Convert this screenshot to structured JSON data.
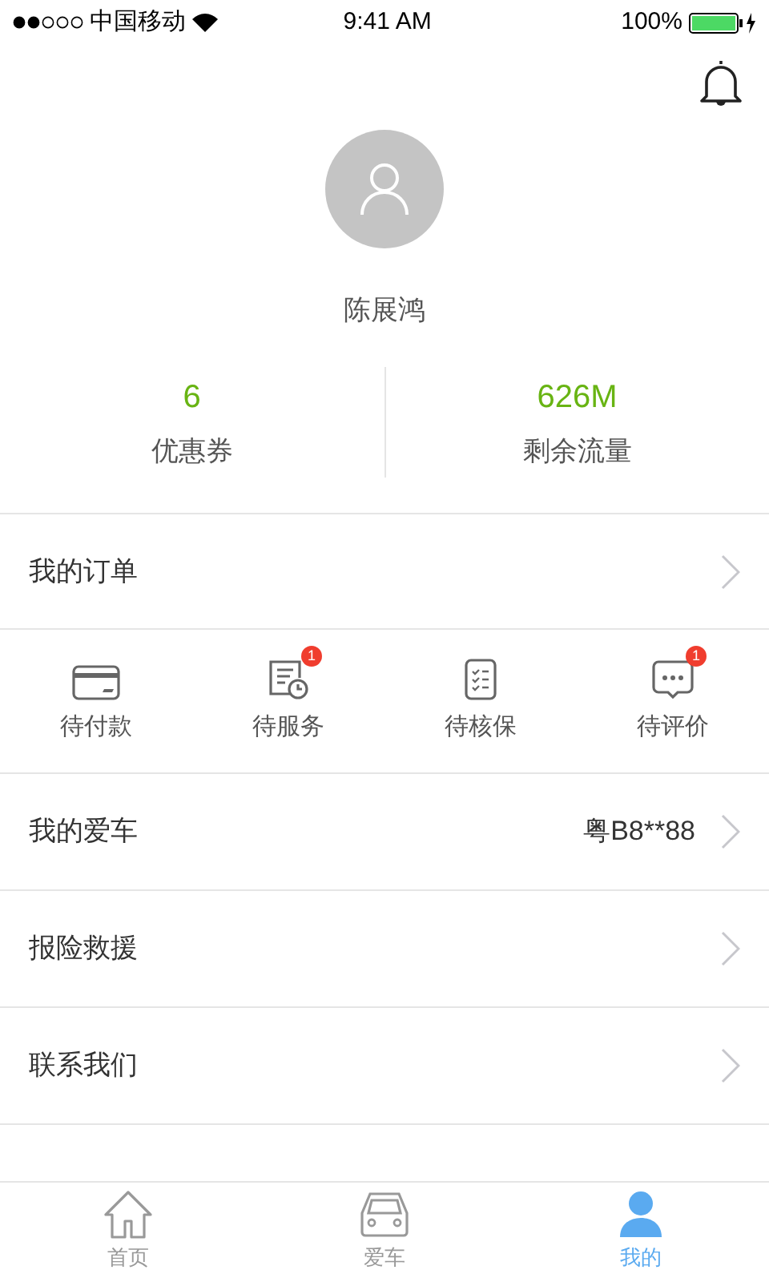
{
  "status_bar": {
    "carrier": "中国移动",
    "time": "9:41 AM",
    "battery": "100%"
  },
  "profile": {
    "name": "陈展鸿"
  },
  "stats": [
    {
      "value": "6",
      "label": "优惠券"
    },
    {
      "value": "626M",
      "label": "剩余流量"
    }
  ],
  "orders_row": {
    "label": "我的订单"
  },
  "order_items": [
    {
      "kind": "payment",
      "label": "待付款"
    },
    {
      "kind": "service",
      "label": "待服务",
      "badge": "1"
    },
    {
      "kind": "checklist",
      "label": "待核保"
    },
    {
      "kind": "review",
      "label": "待评价",
      "badge": "1"
    }
  ],
  "menu": [
    {
      "label": "我的爱车",
      "value": "粤B8**88"
    },
    {
      "label": "报险救援"
    },
    {
      "label": "联系我们"
    }
  ],
  "tab_bar": [
    {
      "kind": "home",
      "label": "首页",
      "selected": false
    },
    {
      "kind": "car",
      "label": "爱车",
      "selected": false
    },
    {
      "kind": "profile",
      "label": "我的",
      "selected": true
    }
  ]
}
